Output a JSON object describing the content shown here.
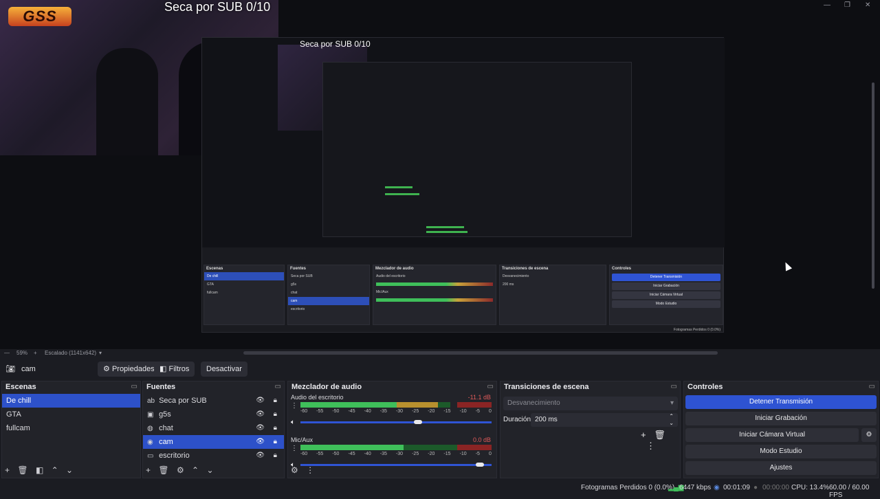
{
  "preview": {
    "overlay_title": "Seca por SUB 0/10",
    "logo_text": "GSS",
    "nested_title": "Seca por SUB 0/10"
  },
  "zoombar": {
    "zoom": "59%",
    "plus": "+",
    "scale_label": "Escalado (1141x642)"
  },
  "toolbar": {
    "source_name": "cam",
    "properties_label": "Propiedades",
    "filters_label": "Filtros",
    "deactivate_label": "Desactivar"
  },
  "scenes": {
    "title": "Escenas",
    "items": [
      "De chill",
      "GTA",
      "fullcam"
    ]
  },
  "sources": {
    "title": "Fuentes",
    "items": [
      {
        "label": "Seca por SUB",
        "icon": "text-icon"
      },
      {
        "label": "g5s",
        "icon": "image-icon"
      },
      {
        "label": "chat",
        "icon": "browser-icon"
      },
      {
        "label": "cam",
        "icon": "camera-icon"
      },
      {
        "label": "escritorio",
        "icon": "monitor-icon"
      }
    ]
  },
  "mixer": {
    "title": "Mezclador de audio",
    "channels": [
      {
        "name": "Audio del escritorio",
        "db": "-11.1 dB",
        "level": 0.62,
        "volume": 0.62
      },
      {
        "name": "Mic/Aux",
        "db": "0.0 dB",
        "level": 0.5,
        "volume": 0.96
      }
    ],
    "ticks": [
      "-60",
      "-55",
      "-50",
      "-45",
      "-40",
      "-35",
      "-30",
      "-25",
      "-20",
      "-15",
      "-10",
      "-5",
      "0"
    ]
  },
  "transitions": {
    "title": "Transiciones de escena",
    "selected": "Desvanecimiento",
    "duration_label": "Duración",
    "duration_value": "200 ms"
  },
  "controls": {
    "title": "Controles",
    "stop_stream": "Detener Transmisión",
    "start_recording": "Iniciar Grabación",
    "start_virtual_cam": "Iniciar Cámara Virtual",
    "studio_mode": "Modo Estudio",
    "settings": "Ajustes"
  },
  "statusbar": {
    "dropped_frames": "Fotogramas Perdidos 0 (0.0%)",
    "bitrate": "6447 kbps",
    "stream_time": "00:01:09",
    "record_time": "00:00:00",
    "cpu": "CPU: 13.4%",
    "fps": "60.00 / 60.00 FPS"
  },
  "colors": {
    "accent_blue": "#2e53d2",
    "meter_green": "#3fbf5a",
    "meter_yellow": "#b8902e",
    "meter_red": "#8a2424"
  }
}
